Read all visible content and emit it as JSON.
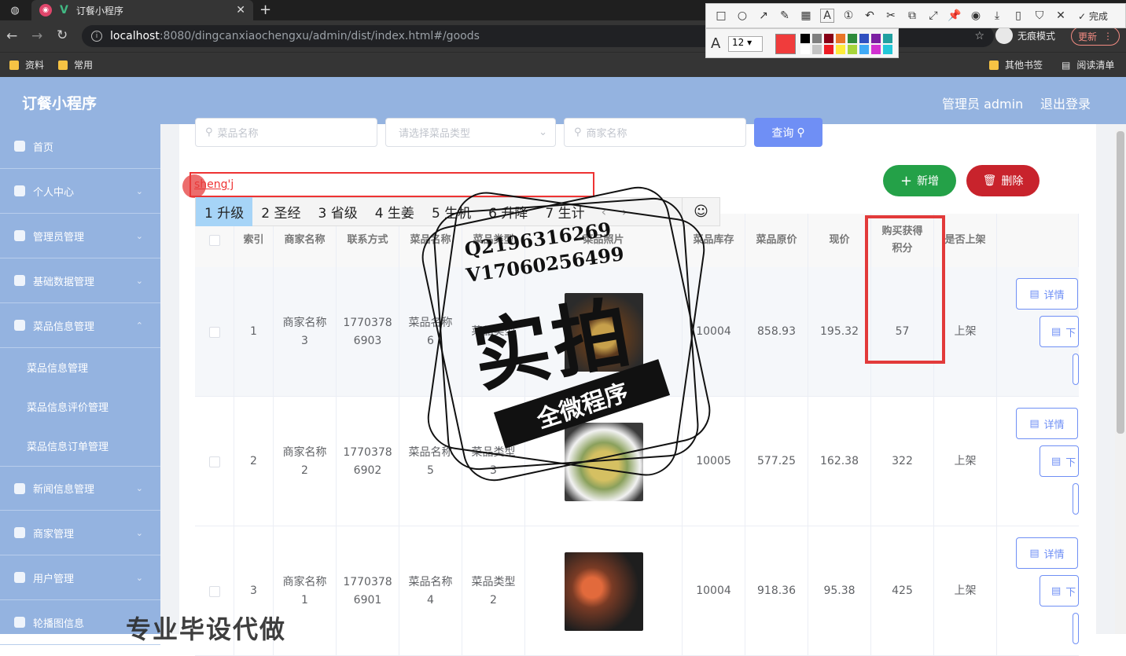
{
  "browser": {
    "tab_title": "订餐小程序",
    "url_host": "localhost",
    "url_path": ":8080/dingcanxiaochengxu/admin/dist/index.html#/goods",
    "incognito_label": "无痕模式",
    "update_label": "更新",
    "bookmarks": [
      "资料",
      "常用"
    ],
    "bookmarks_right": [
      "其他书签",
      "阅读清单"
    ]
  },
  "annotation_tool": {
    "done_label": "完成",
    "font_size": "12",
    "colors": [
      "#000000",
      "#7f7f7f",
      "#880015",
      "#e97527",
      "#2e8b3a",
      "#3050c0",
      "#7b1fa2",
      "#20a0a0",
      "#ffffff",
      "#c3c3c3",
      "#ed1c24",
      "#ffeb3b",
      "#a6d43a",
      "#3fa9f5",
      "#d030d0",
      "#22c7d8"
    ]
  },
  "app": {
    "title": "订餐小程序",
    "admin_label": "管理员 admin",
    "logout_label": "退出登录"
  },
  "sidebar": {
    "items": [
      {
        "label": "首页"
      },
      {
        "label": "个人中心"
      },
      {
        "label": "管理员管理"
      },
      {
        "label": "基础数据管理"
      },
      {
        "label": "菜品信息管理"
      },
      {
        "label": "新闻信息管理"
      },
      {
        "label": "商家管理"
      },
      {
        "label": "用户管理"
      },
      {
        "label": "轮播图信息"
      }
    ],
    "subitems": [
      "菜品信息管理",
      "菜品信息评价管理",
      "菜品信息订单管理"
    ]
  },
  "search": {
    "name_placeholder": "菜品名称",
    "type_placeholder": "请选择菜品类型",
    "merchant_placeholder": "商家名称",
    "query_label": "查询",
    "add_label": "新增",
    "delete_label": "删除"
  },
  "ime": {
    "composition": "sheng'j",
    "candidates": [
      "1 升级",
      "2 圣经",
      "3 省级",
      "4 生姜",
      "5 生机",
      "6 升降",
      "7 生计"
    ]
  },
  "table": {
    "headers": [
      "索引",
      "商家名称",
      "联系方式",
      "菜品名称",
      "菜品类型",
      "菜品照片",
      "菜品库存",
      "菜品原价",
      "现价",
      "购买获得积分",
      "是否上架"
    ],
    "detail_label": "详情",
    "off_label": "下",
    "rows": [
      {
        "index": "1",
        "merchant": "商家名称3",
        "phone": "17703786903",
        "dish": "菜品名称6",
        "type": "菜品类型",
        "stock": "10004",
        "orig": "858.93",
        "price": "195.32",
        "points": "57",
        "status": "上架"
      },
      {
        "index": "2",
        "merchant": "商家名称2",
        "phone": "17703786902",
        "dish": "菜品名称5",
        "type": "菜品类型3",
        "stock": "10005",
        "orig": "577.25",
        "price": "162.38",
        "points": "322",
        "status": "上架"
      },
      {
        "index": "3",
        "merchant": "商家名称1",
        "phone": "17703786901",
        "dish": "菜品名称4",
        "type": "菜品类型2",
        "stock": "10004",
        "orig": "918.36",
        "price": "95.38",
        "points": "425",
        "status": "上架"
      }
    ]
  },
  "watermark": {
    "qq": "Q2196316269",
    "vx": "V17060256499",
    "big": "实拍",
    "ribbon": "全微程序",
    "bottom": "专业毕设代做"
  }
}
